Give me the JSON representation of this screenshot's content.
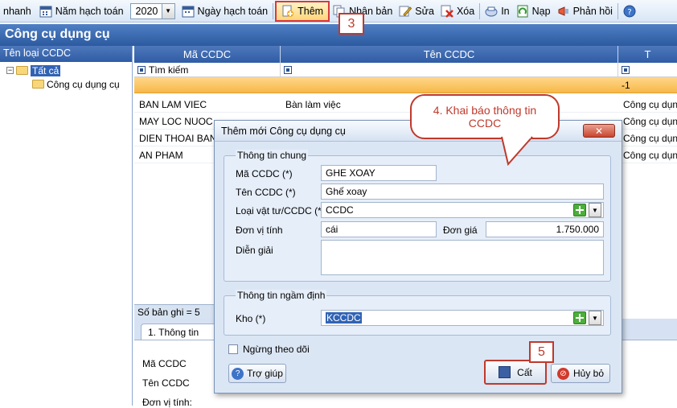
{
  "toolbar": {
    "quick_label": "nhanh",
    "year_label": "Năm hạch toán",
    "year_value": "2020",
    "date_label": "Ngày hạch toán",
    "add": "Thêm",
    "duplicate": "Nhân bản",
    "edit": "Sửa",
    "delete": "Xóa",
    "print": "In",
    "load": "Nạp",
    "feedback": "Phản hồi"
  },
  "annotations": {
    "step3": "3",
    "step4": "4. Khai báo thông tin CCDC",
    "step5": "5"
  },
  "page": {
    "title": "Công cụ dụng cụ"
  },
  "tree": {
    "header": "Tên loại CCDC",
    "root": "Tất cả",
    "child": "Công cụ dụng cụ"
  },
  "grid": {
    "columns": [
      "Mã CCDC",
      "Tên CCDC",
      "T"
    ],
    "filter_placeholder": "Tìm kiếm",
    "orange_value": "-1",
    "rows": [
      {
        "code": "BAN LAM VIEC",
        "name": "Bàn làm việc",
        "type": "Công cụ dụng"
      },
      {
        "code": "MAY LOC NUOC",
        "name": "",
        "type": "Công cụ dụng"
      },
      {
        "code": "DIEN THOAI BAN",
        "name": "",
        "type": "Công cụ dụng"
      },
      {
        "code": "AN PHAM",
        "name": "",
        "type": "Công cụ dụng"
      }
    ],
    "record_count": "Số bản ghi = 5"
  },
  "lower_panel": {
    "tab": "1. Thông tin chung",
    "labels": [
      "Mã CCDC",
      "Tên CCDC",
      "Đơn vị tính:"
    ]
  },
  "dialog": {
    "title": "Thêm mới Công cụ dụng cụ",
    "group_general": "Thông tin chung",
    "code_label": "Mã CCDC (*)",
    "code_value": "GHE XOAY",
    "name_label": "Tên CCDC (*)",
    "name_value": "Ghế xoay",
    "type_label": "Loại vật tư/CCDC (*)",
    "type_value": "CCDC",
    "unit_label": "Đơn vị tính",
    "unit_value": "cái",
    "price_label": "Đơn giá",
    "price_value": "1.750.000",
    "desc_label": "Diễn giải",
    "desc_value": "",
    "group_default": "Thông tin ngầm định",
    "warehouse_label": "Kho (*)",
    "warehouse_value": "KCCDC",
    "stop_tracking": "Ngừng theo dõi",
    "help_button": "Trợ giúp",
    "save_button": "Cất",
    "cancel_button": "Hủy bỏ"
  }
}
